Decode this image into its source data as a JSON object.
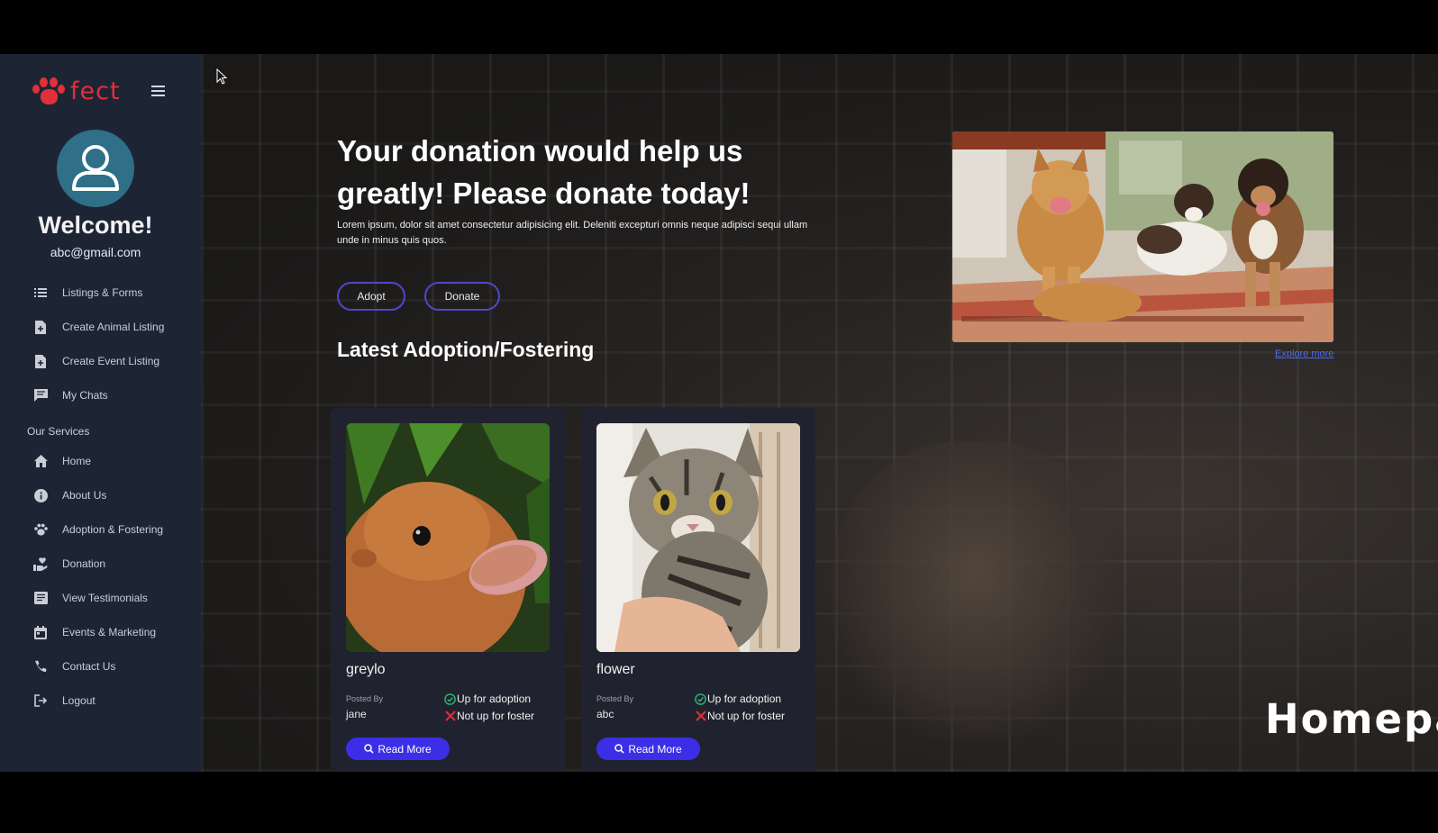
{
  "brand": {
    "logo_text": "fect",
    "accent": "#e0303a"
  },
  "user": {
    "welcome": "Welcome!",
    "email": "abc@gmail.com"
  },
  "sidebar": {
    "items": [
      {
        "label": "Listings & Forms",
        "icon": "list-icon"
      },
      {
        "label": "Create Animal Listing",
        "icon": "file-plus-icon"
      },
      {
        "label": "Create Event Listing",
        "icon": "file-plus-icon"
      },
      {
        "label": "My Chats",
        "icon": "chat-icon"
      }
    ],
    "section_label": "Our Services",
    "services": [
      {
        "label": "Home",
        "icon": "home-icon"
      },
      {
        "label": "About Us",
        "icon": "info-icon"
      },
      {
        "label": "Adoption & Fostering",
        "icon": "paw-icon"
      },
      {
        "label": "Donation",
        "icon": "donation-icon"
      },
      {
        "label": "View Testimonials",
        "icon": "testimonials-icon"
      },
      {
        "label": "Events & Marketing",
        "icon": "calendar-icon"
      },
      {
        "label": "Contact Us",
        "icon": "phone-icon"
      },
      {
        "label": "Logout",
        "icon": "logout-icon"
      }
    ]
  },
  "hero": {
    "title": "Your donation would help us greatly! Please donate today!",
    "text": "Lorem ipsum, dolor sit amet consectetur adipisicing elit. Deleniti excepturi omnis neque adipisci sequi ullam unde in minus quis quos.",
    "adopt_label": "Adopt",
    "donate_label": "Donate",
    "explore_label": "Explore more"
  },
  "latest": {
    "title": "Latest Adoption/Fostering",
    "cards": [
      {
        "name": "greylo",
        "posted_by_label": "Posted By",
        "poster": "jane",
        "adoption": "Up for adoption",
        "foster": "Not up for foster",
        "read_more": "Read More"
      },
      {
        "name": "flower",
        "posted_by_label": "Posted By",
        "poster": "abc",
        "adoption": "Up for adoption",
        "foster": "Not up for foster",
        "read_more": "Read More"
      }
    ]
  },
  "overlay_caption": "Homepage",
  "colors": {
    "sidebar_bg": "#1d2535",
    "button_primary": "#3b2ee6",
    "button_outline": "#5146c8",
    "link": "#4a6cf2",
    "check": "#2eb872",
    "cross": "#e0303a"
  }
}
